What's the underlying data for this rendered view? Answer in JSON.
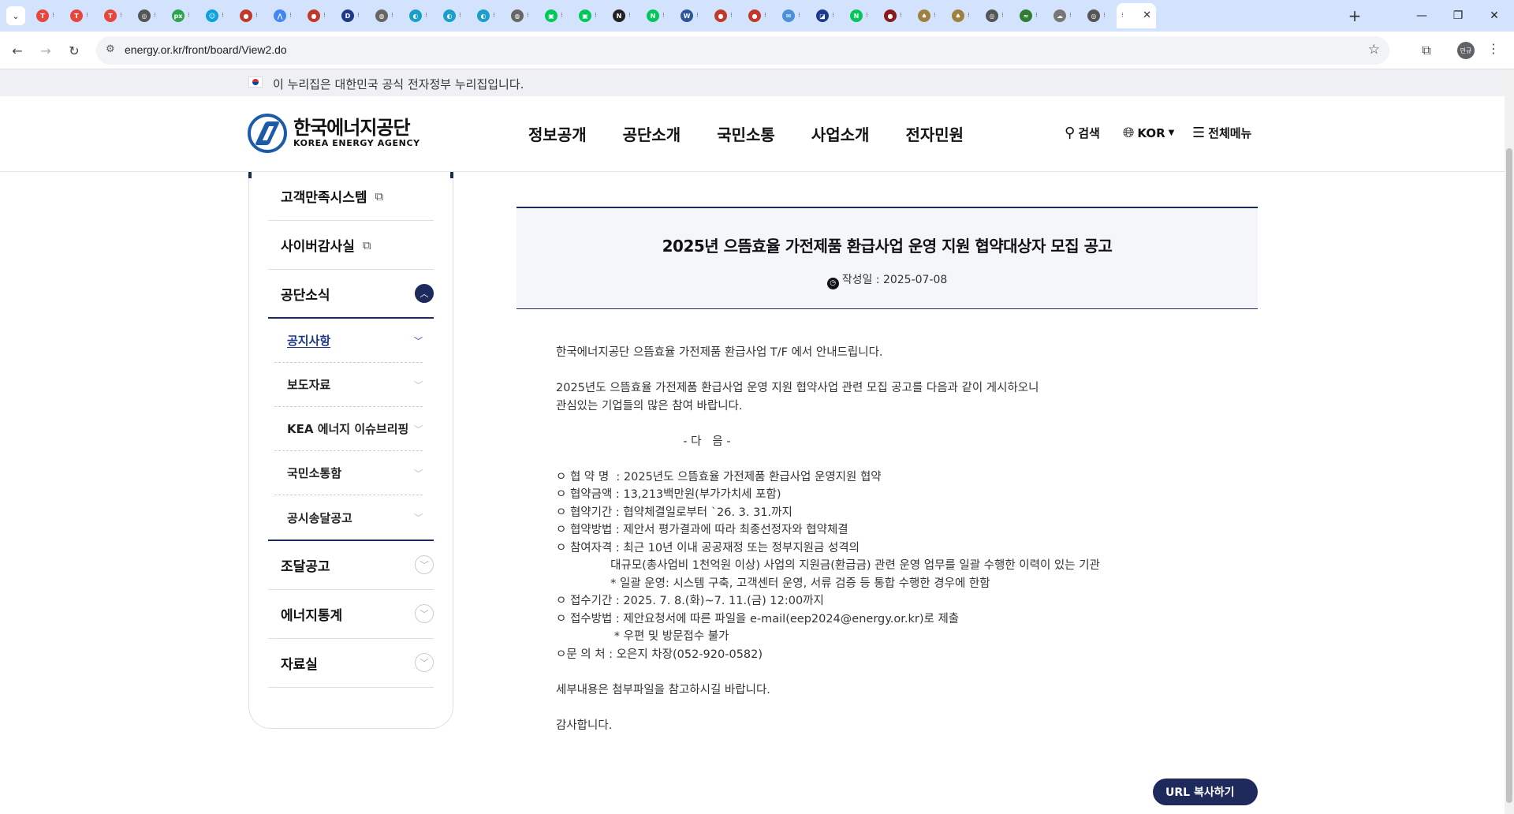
{
  "browser": {
    "tabs": [
      {
        "fav": "T",
        "color": "#e8453c"
      },
      {
        "fav": "T",
        "color": "#e8453c"
      },
      {
        "fav": "T",
        "color": "#e8453c"
      },
      {
        "fav": "◎",
        "color": "#555555"
      },
      {
        "fav": "px",
        "color": "#2ea44f"
      },
      {
        "fav": "☺",
        "color": "#0aa1dd"
      },
      {
        "fav": "●",
        "color": "#c0392b"
      },
      {
        "fav": "⋀",
        "color": "#4285f4"
      },
      {
        "fav": "●",
        "color": "#c0392b"
      },
      {
        "fav": "D",
        "color": "#1d3a8a"
      },
      {
        "fav": "◍",
        "color": "#666666"
      },
      {
        "fav": "◐",
        "color": "#1aa0c8"
      },
      {
        "fav": "◐",
        "color": "#1aa0c8"
      },
      {
        "fav": "◐",
        "color": "#1aa0c8"
      },
      {
        "fav": "◍",
        "color": "#666666"
      },
      {
        "fav": "▣",
        "color": "#03c75a"
      },
      {
        "fav": "▣",
        "color": "#03c75a"
      },
      {
        "fav": "N",
        "color": "#222222"
      },
      {
        "fav": "N",
        "color": "#03c75a"
      },
      {
        "fav": "W",
        "color": "#2b579a"
      },
      {
        "fav": "●",
        "color": "#c0392b"
      },
      {
        "fav": "●",
        "color": "#c0392b"
      },
      {
        "fav": "✉",
        "color": "#4a90d9"
      },
      {
        "fav": "◪",
        "color": "#1d3a8a"
      },
      {
        "fav": "N",
        "color": "#03c75a"
      },
      {
        "fav": "●",
        "color": "#8b1a1a"
      },
      {
        "fav": "♠",
        "color": "#a08040"
      },
      {
        "fav": "♠",
        "color": "#a08040"
      },
      {
        "fav": "◎",
        "color": "#555555"
      },
      {
        "fav": "≈",
        "color": "#2e7d32"
      },
      {
        "fav": "☁",
        "color": "#777777"
      },
      {
        "fav": "◎",
        "color": "#555555"
      }
    ],
    "active_tab_close": "✕",
    "url": "energy.or.kr/front/board/View2.do",
    "profile_label": "민규"
  },
  "gov_banner": {
    "text": "이 누리집은 대한민국 공식 전자정부 누리집입니다."
  },
  "header": {
    "logo_ko": "한국에너지공단",
    "logo_en": "KOREA ENERGY AGENCY",
    "gnb": [
      "정보공개",
      "공단소개",
      "국민소통",
      "사업소개",
      "전자민원"
    ],
    "search_label": "검색",
    "lang_label": "KOR",
    "allmenu_label": "전체메뉴"
  },
  "sidebar": {
    "items_top": [
      {
        "label": "고객만족시스템",
        "external": true
      },
      {
        "label": "사이버감사실",
        "external": true
      }
    ],
    "open_item": "공단소식",
    "sub_items": [
      {
        "label": "공지사항",
        "active": true
      },
      {
        "label": "보도자료",
        "active": false
      },
      {
        "label": "KEA 에너지 이슈브리핑",
        "active": false
      },
      {
        "label": "국민소통함",
        "active": false
      },
      {
        "label": "공시송달공고",
        "active": false
      }
    ],
    "items_bottom": [
      "조달공고",
      "에너지통계",
      "자료실"
    ]
  },
  "article": {
    "title": "2025년 으뜸효율 가전제품 환급사업 운영 지원 협약대상자 모집 공고",
    "date_label": "작성일 : 2025-07-08",
    "body": [
      "한국에너지공단 으뜸효율 가전제품 환급사업 T/F 에서 안내드립니다.",
      "",
      "2025년도 으뜸효율 가전제품 환급사업 운영 지원 협약사업 관련 모집 공고를 다음과 같이 게시하오니",
      "관심있는 기업들의 많은 참여 바랍니다.",
      "",
      "                                   - 다   음 -",
      "",
      "ㅇ 협 약 명  : 2025년도 으뜸효율 가전제품 환급사업 운영지원 협약",
      "ㅇ 협약금액 : 13,213백만원(부가가치세 포함)",
      "ㅇ 협약기간 : 협약체결일로부터 `26. 3. 31.까지",
      "ㅇ 협약방법 : 제안서 평가결과에 따라 최종선정자와 협약체결",
      "ㅇ 참여자격 : 최근 10년 이내 공공재정 또는 정부지원금 성격의",
      "               대규모(총사업비 1천억원 이상) 사업의 지원금(환급금) 관련 운영 업무를 일괄 수행한 이력이 있는 기관",
      "               * 일괄 운영: 시스템 구축, 고객센터 운영, 서류 검증 등 통합 수행한 경우에 한함",
      "ㅇ 접수기간 : 2025. 7. 8.(화)~7. 11.(금) 12:00까지",
      "ㅇ 접수방법 : 제안요청서에 따른 파일을 e-mail(eep2024@energy.or.kr)로 제출",
      "                * 우편 및 방문접수 불가",
      "ㅇ문 의 처 : 오은지 차장(052-920-0582)",
      "",
      "세부내용은 첨부파일을 참고하시길 바랍니다.",
      "",
      "감사합니다."
    ],
    "url_copy_label": "URL 복사하기"
  }
}
